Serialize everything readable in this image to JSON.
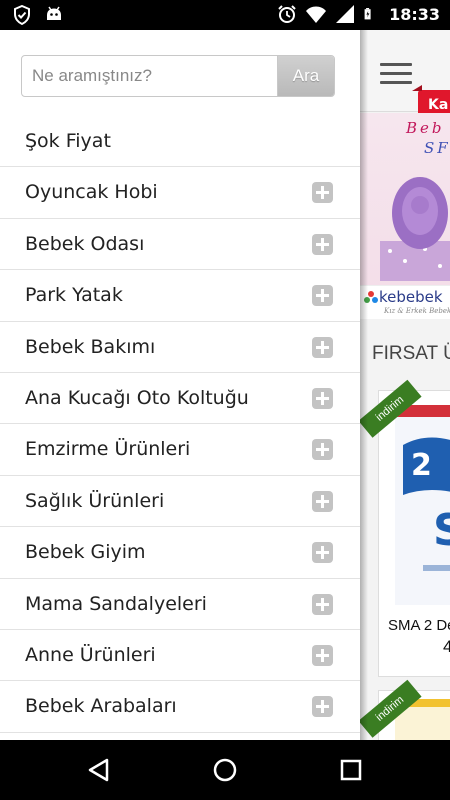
{
  "status_bar": {
    "time": "18:33",
    "icons": [
      "shield-check-icon",
      "android-icon",
      "alarm-icon",
      "wifi-icon",
      "signal-icon",
      "battery-charging-icon"
    ]
  },
  "drawer": {
    "search": {
      "placeholder": "Ne aramıştınız?",
      "value": "",
      "button_label": "Ara"
    },
    "menu_items": [
      {
        "label": "Şok Fiyat",
        "expandable": false
      },
      {
        "label": "Oyuncak Hobi",
        "expandable": true
      },
      {
        "label": "Bebek Odası",
        "expandable": true
      },
      {
        "label": "Park Yatak",
        "expandable": true
      },
      {
        "label": "Bebek Bakımı",
        "expandable": true
      },
      {
        "label": "Ana Kucağı Oto Koltuğu",
        "expandable": true
      },
      {
        "label": "Emzirme Ürünleri",
        "expandable": true
      },
      {
        "label": "Sağlık Ürünleri",
        "expandable": true
      },
      {
        "label": "Bebek Giyim",
        "expandable": true
      },
      {
        "label": "Mama Sandalyeleri",
        "expandable": true
      },
      {
        "label": "Anne Ürünleri",
        "expandable": true
      },
      {
        "label": "Bebek Arabaları",
        "expandable": true
      }
    ]
  },
  "background_page": {
    "badge": "Ka",
    "banner": {
      "line1": "Beb",
      "line2": "SF",
      "brand": "kebebek",
      "tagline": "Kız & Erkek Bebek"
    },
    "section_title": "FIRSAT Ü",
    "products": [
      {
        "ribbon": "indirim",
        "name": "SMA 2 De",
        "price": "4"
      },
      {
        "ribbon": "indirim"
      }
    ]
  },
  "nav_bar": {
    "icons": [
      "back-icon",
      "home-icon",
      "recents-icon"
    ]
  },
  "colors": {
    "status_bar": "#000000",
    "badge": "#e0172c",
    "ribbon": "#3a7d22",
    "plus_icon": "#c3c3c3"
  }
}
